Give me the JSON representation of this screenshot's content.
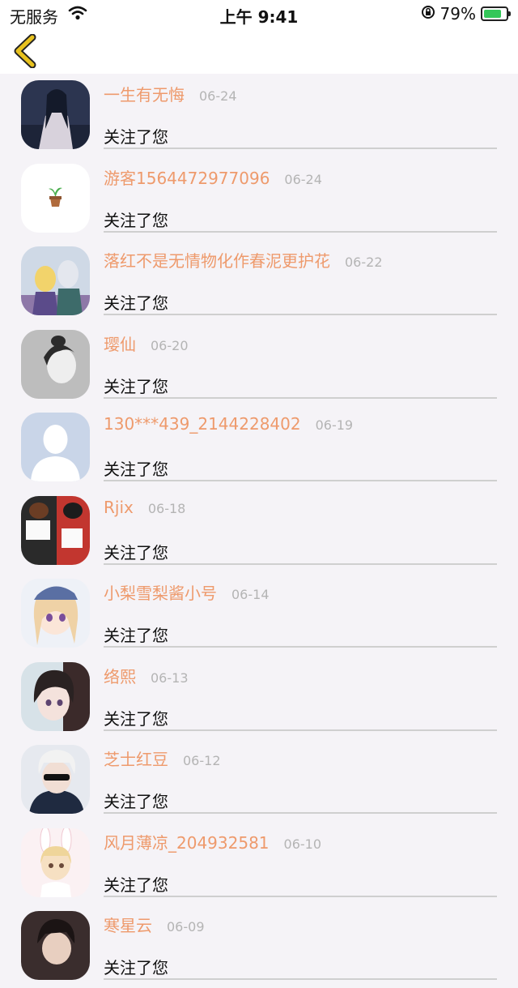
{
  "status_bar": {
    "carrier": "无服务",
    "time": "上午 9:41",
    "battery": "79%",
    "battery_level": 0.79,
    "icons": [
      "wifi-icon",
      "orientation-lock-icon",
      "battery-charging-icon"
    ]
  },
  "nav": {
    "back_icon": "chevron-left-icon"
  },
  "follows": [
    {
      "name": "一生有无悔",
      "date": "06-24",
      "message": "关注了您"
    },
    {
      "name": "游客1564472977096",
      "date": "06-24",
      "message": "关注了您"
    },
    {
      "name": "落红不是无情物化作春泥更护花",
      "date": "06-22",
      "message": "关注了您"
    },
    {
      "name": "璎仙",
      "date": "06-20",
      "message": "关注了您"
    },
    {
      "name": "130***439_2144228402",
      "date": "06-19",
      "message": "关注了您"
    },
    {
      "name": "Rjix",
      "date": "06-18",
      "message": "关注了您"
    },
    {
      "name": "小梨雪梨酱小号",
      "date": "06-14",
      "message": "关注了您"
    },
    {
      "name": "络熙",
      "date": "06-13",
      "message": "关注了您"
    },
    {
      "name": "芝士红豆",
      "date": "06-12",
      "message": "关注了您"
    },
    {
      "name": "风月薄凉_204932581",
      "date": "06-10",
      "message": "关注了您"
    },
    {
      "name": "寒星云",
      "date": "06-09",
      "message": "关注了您"
    }
  ],
  "colors": {
    "name": "#ee9a6c",
    "date": "#b4b4b4",
    "back_arrow": "#e8c21f",
    "background": "#f5f3f7"
  }
}
